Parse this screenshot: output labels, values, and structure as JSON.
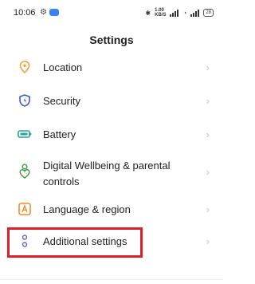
{
  "status_bar": {
    "time": "10:06",
    "net_speed_value": "1.00",
    "net_speed_unit": "KB/S",
    "battery": "28"
  },
  "header": {
    "title": "Settings"
  },
  "settings": {
    "items": [
      {
        "label": "Location",
        "icon": "location-icon"
      },
      {
        "label": "Security",
        "icon": "security-shield-icon"
      },
      {
        "label": "Battery",
        "icon": "battery-icon"
      },
      {
        "label": "Digital Wellbeing & parental controls",
        "label_line1": "Digital Wellbeing & parental",
        "label_line2": "controls",
        "icon": "wellbeing-icon"
      },
      {
        "label": "Language & region",
        "icon": "language-icon"
      },
      {
        "label": "Additional settings",
        "icon": "additional-settings-icon"
      }
    ]
  },
  "colors": {
    "highlight": "#e11d2a",
    "location": "#f2a23a",
    "security": "#3b5bdb",
    "battery": "#26a69a",
    "wellbeing": "#43a047",
    "language": "#f28b2d",
    "additional": "#5c6bc0"
  }
}
